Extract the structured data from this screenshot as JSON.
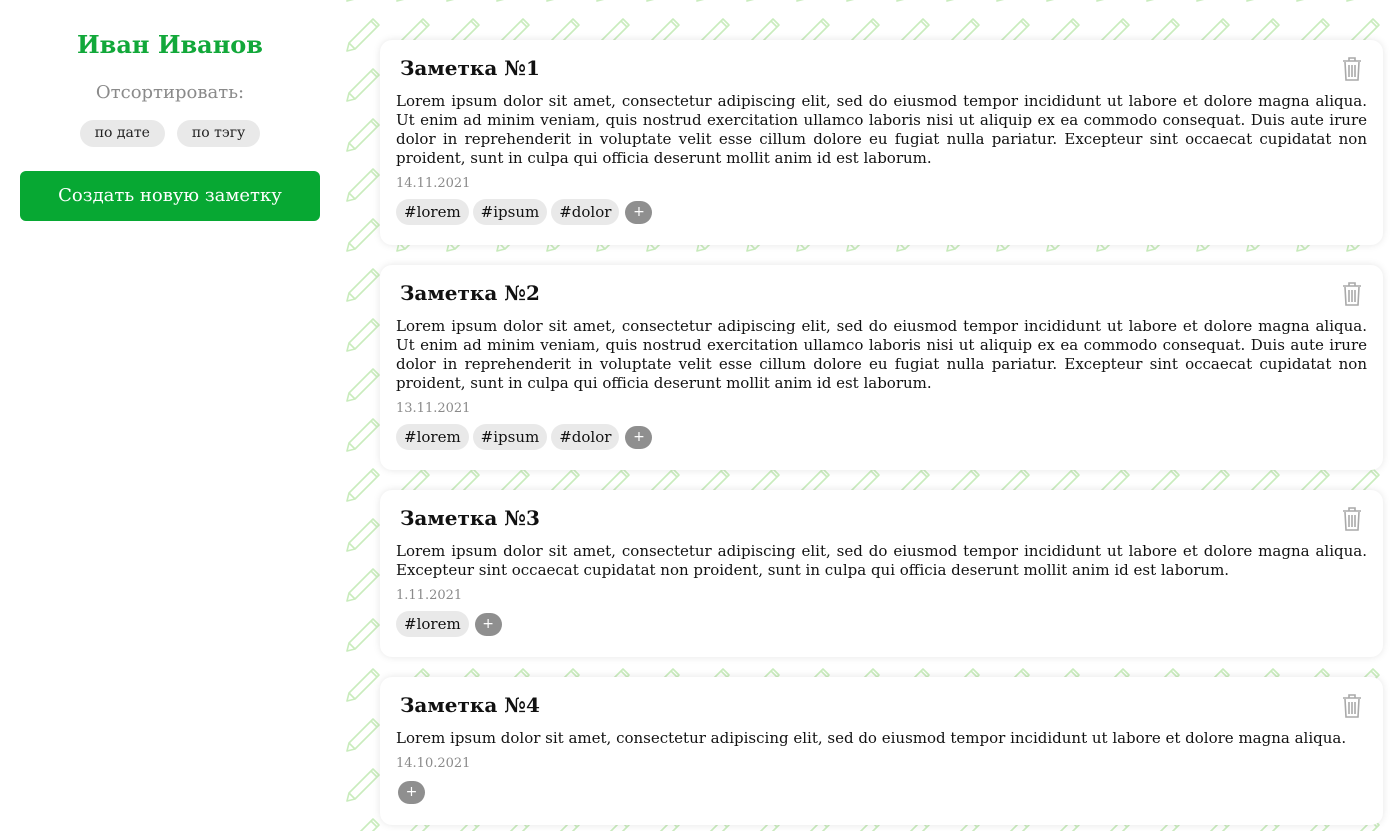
{
  "sidebar": {
    "user_name": "Иван Иванов",
    "sort_label": "Отсортировать:",
    "sort_by_date": "по дате",
    "sort_by_tag": "по тэгу",
    "create_note": "Создать новую заметку"
  },
  "colors": {
    "accent": "#07a833",
    "name": "#12a83a",
    "pattern": "#c9ecbd"
  },
  "notes": [
    {
      "title": "Заметка №1",
      "text": "Lorem ipsum dolor sit amet, consectetur adipiscing elit, sed do eiusmod tempor incididunt ut labore et dolore magna aliqua. Ut enim ad minim veniam, quis nostrud exercitation ullamco laboris nisi ut aliquip ex ea commodo consequat. Duis aute irure dolor in reprehenderit in voluptate velit esse cillum dolore eu fugiat nulla pariatur. Excepteur sint occaecat cupidatat non proident, sunt in culpa qui officia deserunt mollit anim id est laborum.",
      "date": "14.11.2021",
      "tags": [
        "#lorem",
        "#ipsum",
        "#dolor"
      ],
      "add_tag": "+"
    },
    {
      "title": "Заметка №2",
      "text": "Lorem ipsum dolor sit amet, consectetur adipiscing elit, sed do eiusmod tempor incididunt ut labore et dolore magna aliqua. Ut enim ad minim veniam, quis nostrud exercitation ullamco laboris nisi ut aliquip ex ea commodo consequat. Duis aute irure dolor in reprehenderit in voluptate velit esse cillum dolore eu fugiat nulla pariatur. Excepteur sint occaecat cupidatat non proident, sunt in culpa qui officia deserunt mollit anim id est laborum.",
      "date": "13.11.2021",
      "tags": [
        "#lorem",
        "#ipsum",
        "#dolor"
      ],
      "add_tag": "+"
    },
    {
      "title": "Заметка №3",
      "text": "Lorem ipsum dolor sit amet, consectetur adipiscing elit, sed do eiusmod tempor incididunt ut labore et dolore magna aliqua. Excepteur sint occaecat cupidatat non proident, sunt in culpa qui officia deserunt mollit anim id est laborum.",
      "date": "1.11.2021",
      "tags": [
        "#lorem"
      ],
      "add_tag": "+"
    },
    {
      "title": "Заметка №4",
      "text": "Lorem ipsum dolor sit amet, consectetur adipiscing elit, sed do eiusmod tempor incididunt ut labore et dolore magna aliqua.",
      "date": "14.10.2021",
      "tags": [],
      "add_tag": "+"
    }
  ]
}
